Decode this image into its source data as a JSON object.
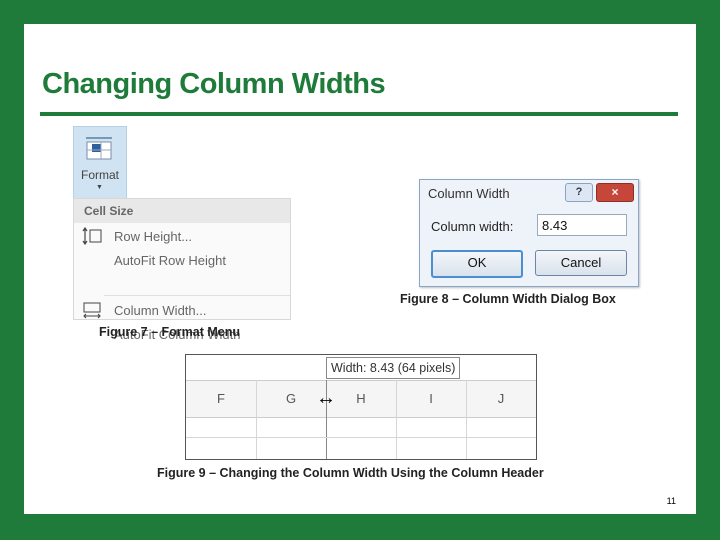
{
  "slide": {
    "title": "Changing Column Widths",
    "page_number": "11"
  },
  "figure7": {
    "ribbon_button_label": "Format",
    "menu_header": "Cell Size",
    "items": [
      "Row Height...",
      "AutoFit Row Height",
      "Column Width...",
      "AutoFit Column Width"
    ],
    "caption": "Figure 7 – Format Menu"
  },
  "figure8": {
    "dialog_title": "Column Width",
    "help_label": "?",
    "close_label": "×",
    "field_label": "Column width:",
    "field_value": "8.43",
    "ok_label": "OK",
    "cancel_label": "Cancel",
    "caption": "Figure 8 – Column Width Dialog Box"
  },
  "figure9": {
    "tooltip": "Width: 8.43 (64 pixels)",
    "columns": [
      "F",
      "G",
      "H",
      "I",
      "J"
    ],
    "caption": "Figure 9 – Changing the Column Width Using the Column Header"
  }
}
